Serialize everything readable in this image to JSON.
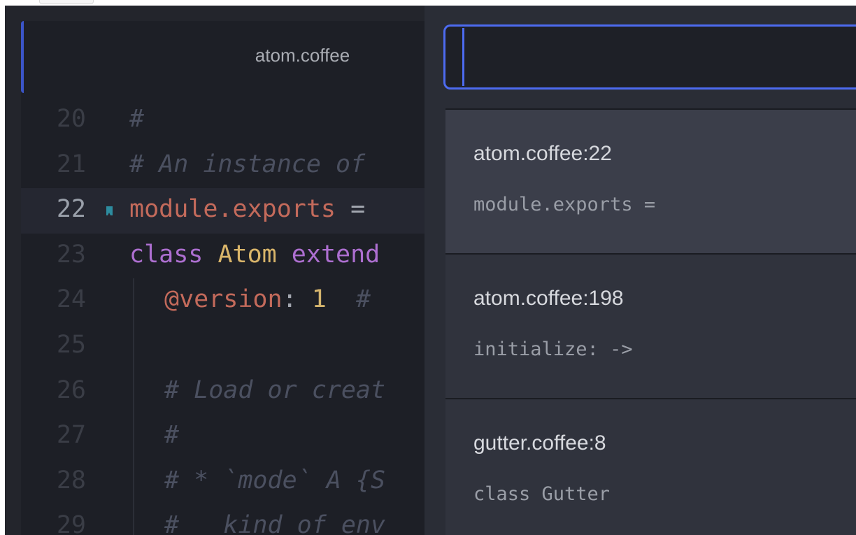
{
  "editor": {
    "tab_title": "atom.coffee",
    "lines": [
      {
        "number": "20",
        "text": "#"
      },
      {
        "number": "21",
        "text": "# An instance of"
      },
      {
        "number": "22",
        "text_module": "module.exports",
        "text_op": " ="
      },
      {
        "number": "23",
        "text_kw": "class ",
        "text_class": "Atom ",
        "text_kw2": "extend"
      },
      {
        "number": "24",
        "text_attr": "@version",
        "text_op": ": ",
        "text_num": "1",
        "text_comment": "  # "
      },
      {
        "number": "25",
        "text": ""
      },
      {
        "number": "26",
        "text": "# Load or creat"
      },
      {
        "number": "27",
        "text": "#"
      },
      {
        "number": "28",
        "text": "# * `mode` A {S"
      },
      {
        "number": "29",
        "text": "#   kind of env"
      }
    ]
  },
  "palette": {
    "query": "",
    "results": [
      {
        "title": "atom.coffee:22",
        "code": "module.exports ="
      },
      {
        "title": "atom.coffee:198",
        "code": "initialize: ->"
      },
      {
        "title": "gutter.coffee:8",
        "code": "class Gutter"
      }
    ]
  },
  "colors": {
    "accent": "#4d6bf0",
    "bookmark": "#2d8c9f"
  }
}
